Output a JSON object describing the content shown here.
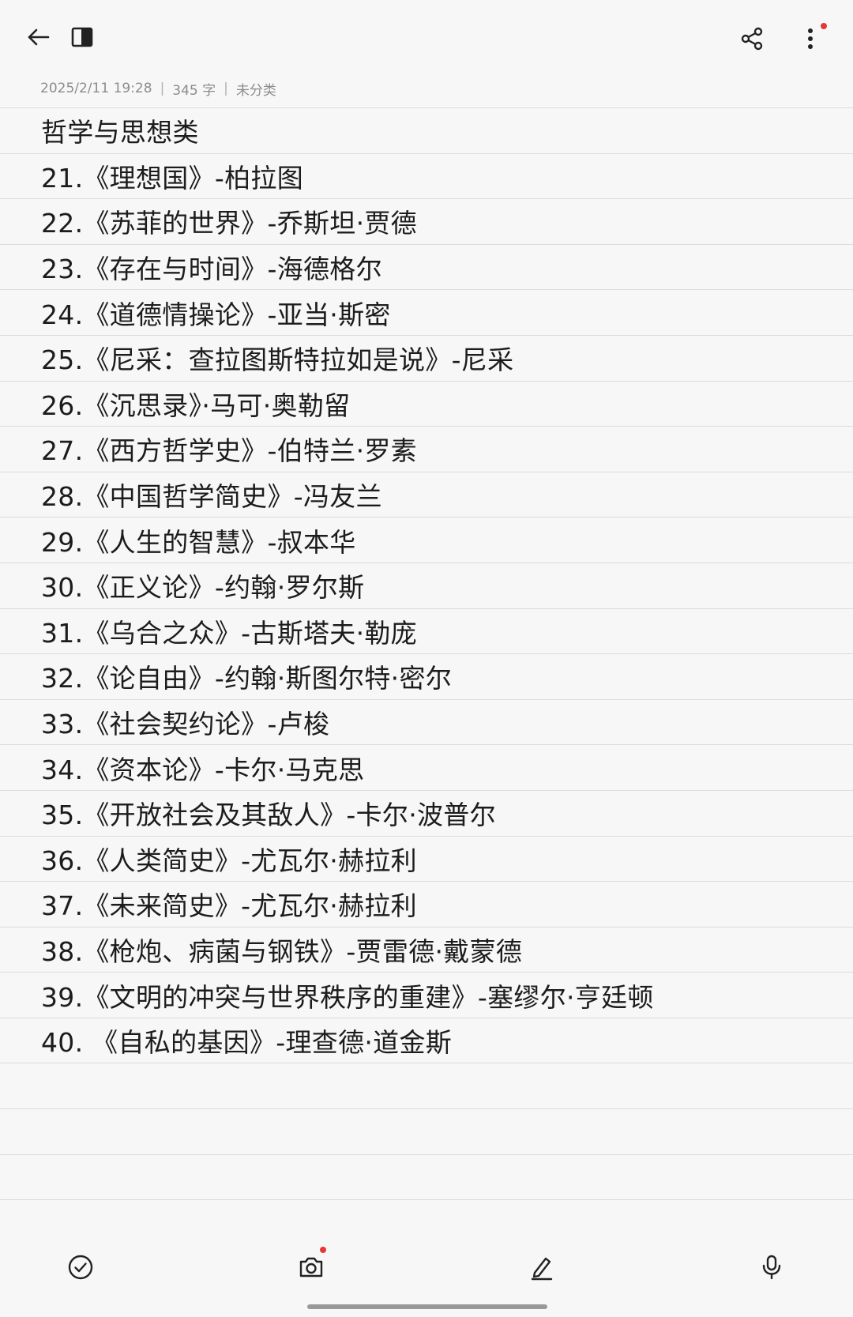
{
  "meta": {
    "datetime": "2025/2/11 19:28",
    "word_count": "345 字",
    "category": "未分类",
    "separator": "|"
  },
  "note": {
    "lines": [
      "哲学与思想类",
      "21.《理想国》-柏拉图",
      "22.《苏菲的世界》-乔斯坦·贾德",
      "23.《存在与时间》-海德格尔",
      "24.《道德情操论》-亚当·斯密",
      "25.《尼采：查拉图斯特拉如是说》-尼采",
      "26.《沉思录》·马可·奥勒留",
      "27.《西方哲学史》-伯特兰·罗素",
      "28.《中国哲学简史》-冯友兰",
      "29.《人生的智慧》-叔本华",
      "30.《正义论》-约翰·罗尔斯",
      "31.《乌合之众》-古斯塔夫·勒庞",
      "32.《论自由》-约翰·斯图尔特·密尔",
      "33.《社会契约论》-卢梭",
      "34.《资本论》-卡尔·马克思",
      "35.《开放社会及其敌人》-卡尔·波普尔",
      "36.《人类简史》-尤瓦尔·赫拉利",
      "37.《未来简史》-尤瓦尔·赫拉利",
      "38.《枪炮、病菌与钢铁》-贾雷德·戴蒙德",
      "39.《文明的冲突与世界秩序的重建》-塞缪尔·亨廷顿",
      "40. 《自私的基因》-理查德·道金斯",
      "",
      "",
      ""
    ]
  },
  "icons": {
    "back": "arrow-left-icon",
    "sidebar": "sidebar-toggle-icon",
    "share": "share-icon",
    "more": "more-vertical-icon",
    "checklist": "check-circle-icon",
    "camera": "camera-icon",
    "draw": "pen-icon",
    "voice": "microphone-icon"
  },
  "colors": {
    "background": "#f7f7f7",
    "ruled_line": "#dcdcdc",
    "meta_text": "#8c8c8c",
    "notification_dot": "#e53935"
  }
}
